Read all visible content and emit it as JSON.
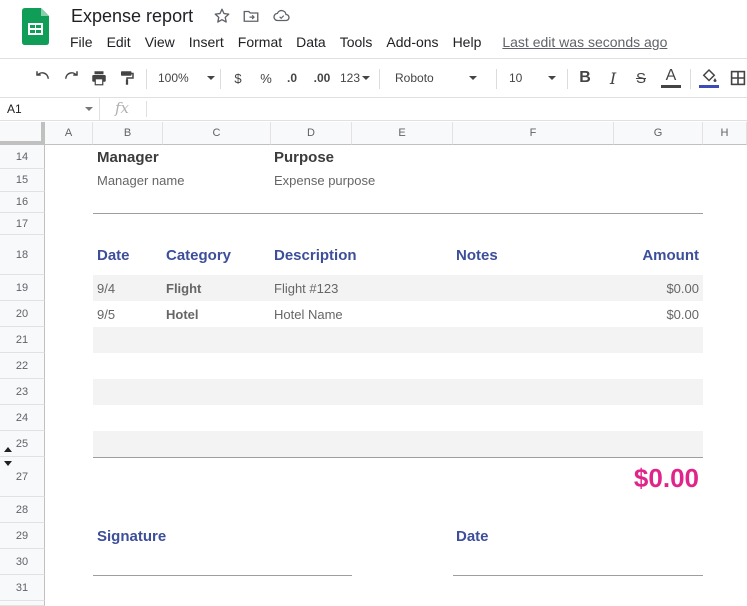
{
  "app": {
    "title": "Expense report",
    "menu": [
      "File",
      "Edit",
      "View",
      "Insert",
      "Format",
      "Data",
      "Tools",
      "Add-ons",
      "Help"
    ],
    "last_edit": "Last edit was seconds ago"
  },
  "toolbar": {
    "zoom": "100%",
    "currency": "$",
    "percent": "%",
    "decrease_decimals": ".0",
    "increase_decimals": ".00",
    "more_formats": "123",
    "font": "Roboto",
    "font_size": "10",
    "accent_color": "#3c4bb5"
  },
  "formula_bar": {
    "cell_ref": "A1",
    "fx": "fx"
  },
  "columns": [
    "A",
    "B",
    "C",
    "D",
    "E",
    "F",
    "G",
    "H"
  ],
  "rows": [
    "14",
    "15",
    "16",
    "17",
    "18",
    "19",
    "20",
    "21",
    "22",
    "23",
    "24",
    "25",
    "27",
    "28",
    "29",
    "30",
    "31"
  ],
  "sheet": {
    "manager_label": "Manager",
    "manager_value": "Manager name",
    "purpose_label": "Purpose",
    "purpose_value": "Expense purpose",
    "table_headers": {
      "date": "Date",
      "category": "Category",
      "description": "Description",
      "notes": "Notes",
      "amount": "Amount"
    },
    "items": [
      {
        "date": "9/4",
        "category": "Flight",
        "description": "Flight #123",
        "amount": "$0.00"
      },
      {
        "date": "9/5",
        "category": "Hotel",
        "description": "Hotel Name",
        "amount": "$0.00"
      }
    ],
    "total": "$0.00",
    "signature_label": "Signature",
    "date_label": "Date"
  },
  "colors": {
    "header_blue": "#3d4e9a",
    "total_pink": "#e0248a",
    "sheets_green": "#0f9d58"
  }
}
